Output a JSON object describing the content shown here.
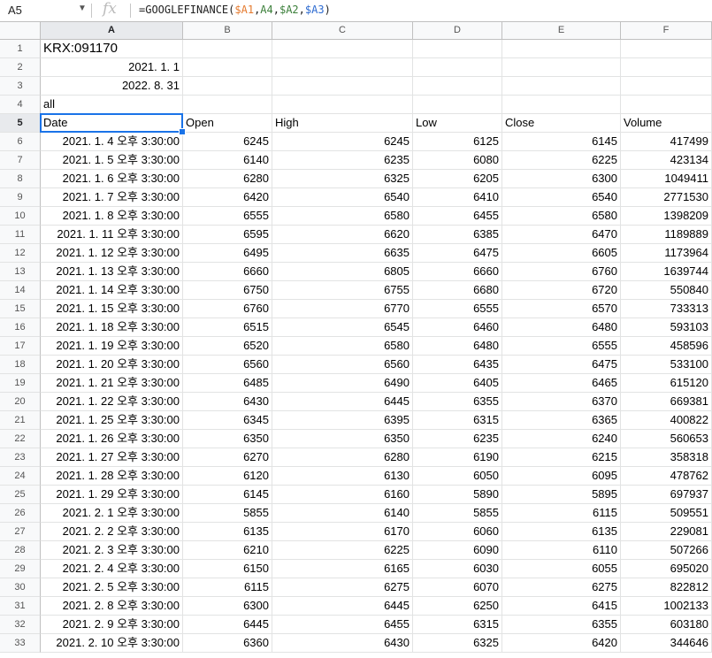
{
  "formula_bar": {
    "name_box": "A5",
    "fx_label": "fx",
    "formula_prefix": "=GOOGLEFINANCE(",
    "ref1": "$A1",
    "comma1": ",",
    "ref2": "A4",
    "comma2": ",",
    "ref3": "$A2",
    "comma3": ",",
    "ref4": "$A3",
    "formula_suffix": ")"
  },
  "columns": [
    "A",
    "B",
    "C",
    "D",
    "E",
    "F"
  ],
  "selected_cell": "A5",
  "rows": [
    {
      "n": "1",
      "cells": [
        "KRX:091170",
        "",
        "",
        "",
        "",
        ""
      ]
    },
    {
      "n": "2",
      "cells": [
        "2021. 1. 1",
        "",
        "",
        "",
        "",
        ""
      ]
    },
    {
      "n": "3",
      "cells": [
        "2022. 8. 31",
        "",
        "",
        "",
        "",
        ""
      ]
    },
    {
      "n": "4",
      "cells": [
        "all",
        "",
        "",
        "",
        "",
        ""
      ]
    },
    {
      "n": "5",
      "cells": [
        "Date",
        "Open",
        "High",
        "Low",
        "Close",
        "Volume"
      ]
    },
    {
      "n": "6",
      "cells": [
        "2021. 1. 4 오후 3:30:00",
        "6245",
        "6245",
        "6125",
        "6145",
        "417499"
      ]
    },
    {
      "n": "7",
      "cells": [
        "2021. 1. 5 오후 3:30:00",
        "6140",
        "6235",
        "6080",
        "6225",
        "423134"
      ]
    },
    {
      "n": "8",
      "cells": [
        "2021. 1. 6 오후 3:30:00",
        "6280",
        "6325",
        "6205",
        "6300",
        "1049411"
      ]
    },
    {
      "n": "9",
      "cells": [
        "2021. 1. 7 오후 3:30:00",
        "6420",
        "6540",
        "6410",
        "6540",
        "2771530"
      ]
    },
    {
      "n": "10",
      "cells": [
        "2021. 1. 8 오후 3:30:00",
        "6555",
        "6580",
        "6455",
        "6580",
        "1398209"
      ]
    },
    {
      "n": "11",
      "cells": [
        "2021. 1. 11 오후 3:30:00",
        "6595",
        "6620",
        "6385",
        "6470",
        "1189889"
      ]
    },
    {
      "n": "12",
      "cells": [
        "2021. 1. 12 오후 3:30:00",
        "6495",
        "6635",
        "6475",
        "6605",
        "1173964"
      ]
    },
    {
      "n": "13",
      "cells": [
        "2021. 1. 13 오후 3:30:00",
        "6660",
        "6805",
        "6660",
        "6760",
        "1639744"
      ]
    },
    {
      "n": "14",
      "cells": [
        "2021. 1. 14 오후 3:30:00",
        "6750",
        "6755",
        "6680",
        "6720",
        "550840"
      ]
    },
    {
      "n": "15",
      "cells": [
        "2021. 1. 15 오후 3:30:00",
        "6760",
        "6770",
        "6555",
        "6570",
        "733313"
      ]
    },
    {
      "n": "16",
      "cells": [
        "2021. 1. 18 오후 3:30:00",
        "6515",
        "6545",
        "6460",
        "6480",
        "593103"
      ]
    },
    {
      "n": "17",
      "cells": [
        "2021. 1. 19 오후 3:30:00",
        "6520",
        "6580",
        "6480",
        "6555",
        "458596"
      ]
    },
    {
      "n": "18",
      "cells": [
        "2021. 1. 20 오후 3:30:00",
        "6560",
        "6560",
        "6435",
        "6475",
        "533100"
      ]
    },
    {
      "n": "19",
      "cells": [
        "2021. 1. 21 오후 3:30:00",
        "6485",
        "6490",
        "6405",
        "6465",
        "615120"
      ]
    },
    {
      "n": "20",
      "cells": [
        "2021. 1. 22 오후 3:30:00",
        "6430",
        "6445",
        "6355",
        "6370",
        "669381"
      ]
    },
    {
      "n": "21",
      "cells": [
        "2021. 1. 25 오후 3:30:00",
        "6345",
        "6395",
        "6315",
        "6365",
        "400822"
      ]
    },
    {
      "n": "22",
      "cells": [
        "2021. 1. 26 오후 3:30:00",
        "6350",
        "6350",
        "6235",
        "6240",
        "560653"
      ]
    },
    {
      "n": "23",
      "cells": [
        "2021. 1. 27 오후 3:30:00",
        "6270",
        "6280",
        "6190",
        "6215",
        "358318"
      ]
    },
    {
      "n": "24",
      "cells": [
        "2021. 1. 28 오후 3:30:00",
        "6120",
        "6130",
        "6050",
        "6095",
        "478762"
      ]
    },
    {
      "n": "25",
      "cells": [
        "2021. 1. 29 오후 3:30:00",
        "6145",
        "6160",
        "5890",
        "5895",
        "697937"
      ]
    },
    {
      "n": "26",
      "cells": [
        "2021. 2. 1 오후 3:30:00",
        "5855",
        "6140",
        "5855",
        "6115",
        "509551"
      ]
    },
    {
      "n": "27",
      "cells": [
        "2021. 2. 2 오후 3:30:00",
        "6135",
        "6170",
        "6060",
        "6135",
        "229081"
      ]
    },
    {
      "n": "28",
      "cells": [
        "2021. 2. 3 오후 3:30:00",
        "6210",
        "6225",
        "6090",
        "6110",
        "507266"
      ]
    },
    {
      "n": "29",
      "cells": [
        "2021. 2. 4 오후 3:30:00",
        "6150",
        "6165",
        "6030",
        "6055",
        "695020"
      ]
    },
    {
      "n": "30",
      "cells": [
        "2021. 2. 5 오후 3:30:00",
        "6115",
        "6275",
        "6070",
        "6275",
        "822812"
      ]
    },
    {
      "n": "31",
      "cells": [
        "2021. 2. 8 오후 3:30:00",
        "6300",
        "6445",
        "6250",
        "6415",
        "1002133"
      ]
    },
    {
      "n": "32",
      "cells": [
        "2021. 2. 9 오후 3:30:00",
        "6445",
        "6455",
        "6315",
        "6355",
        "603180"
      ]
    },
    {
      "n": "33",
      "cells": [
        "2021. 2. 10 오후 3:30:00",
        "6360",
        "6430",
        "6325",
        "6420",
        "344646"
      ]
    }
  ]
}
